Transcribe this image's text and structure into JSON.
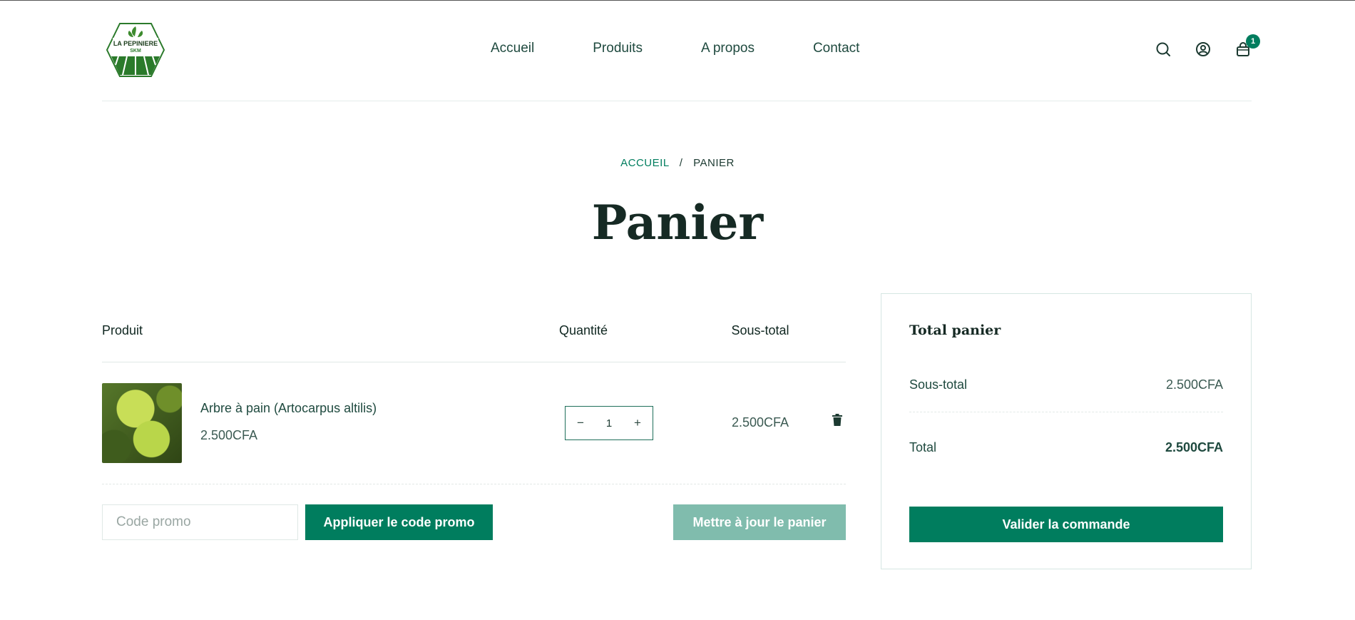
{
  "logo": {
    "line1": "LA PEPINIERE",
    "line2": "SKM"
  },
  "nav": [
    "Accueil",
    "Produits",
    "A propos",
    "Contact"
  ],
  "header_icons": {
    "search": "search-icon",
    "account": "user-circle-icon",
    "cart": "shopping-bag-icon",
    "cart_count": "1"
  },
  "breadcrumb": {
    "home": "ACCUEIL",
    "separator": "/",
    "current": "PANIER"
  },
  "page_title": "Panier",
  "table": {
    "headers": {
      "product": "Produit",
      "quantity": "Quantité",
      "subtotal": "Sous-total"
    },
    "items": [
      {
        "name": "Arbre à pain (Artocarpus altilis)",
        "price": "2.500CFA",
        "quantity": "1",
        "subtotal": "2.500CFA"
      }
    ]
  },
  "qty_controls": {
    "minus": "−",
    "plus": "+"
  },
  "promo": {
    "placeholder": "Code promo",
    "apply_label": "Appliquer le code promo"
  },
  "update_label": "Mettre à jour le panier",
  "totals": {
    "title": "Total panier",
    "subtotal_label": "Sous-total",
    "subtotal_value": "2.500CFA",
    "total_label": "Total",
    "total_value": "2.500CFA",
    "checkout_label": "Valider la commande"
  },
  "colors": {
    "primary": "#007d5e",
    "primary_light": "#80bcad",
    "text_dark": "#162a24",
    "text": "#1f4a3f"
  }
}
